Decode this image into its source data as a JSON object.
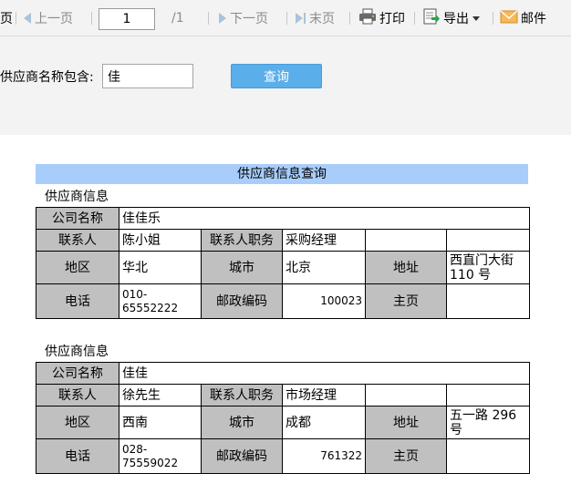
{
  "toolbar": {
    "first_fragment": "页",
    "prev_label": "上一页",
    "page_value": "1",
    "total_pages": "/1",
    "next_label": "下一页",
    "last_label": "末页",
    "print_label": "打印",
    "export_label": "导出",
    "email_label": "邮件"
  },
  "search": {
    "label": "供应商名称包含:",
    "value": "佳",
    "button_label": "查询"
  },
  "report": {
    "title": "供应商信息查询",
    "labels": {
      "section": "供应商信息",
      "company": "公司名称",
      "contact": "联系人",
      "contact_title": "联系人职务",
      "region": "地区",
      "city": "城市",
      "address": "地址",
      "phone": "电话",
      "postal": "邮政编码",
      "homepage": "主页"
    },
    "suppliers": [
      {
        "company": "佳佳乐",
        "contact": "陈小姐",
        "contact_title": "采购经理",
        "region": "华北",
        "city": "北京",
        "address": "西直门大街 110 号",
        "phone": "010-65552222",
        "postal": "100023",
        "homepage": ""
      },
      {
        "company": "佳佳",
        "contact": "徐先生",
        "contact_title": "市场经理",
        "region": "西南",
        "city": "成都",
        "address": "五一路 296 号",
        "phone": "028-75559022",
        "postal": "761322",
        "homepage": ""
      }
    ]
  }
}
